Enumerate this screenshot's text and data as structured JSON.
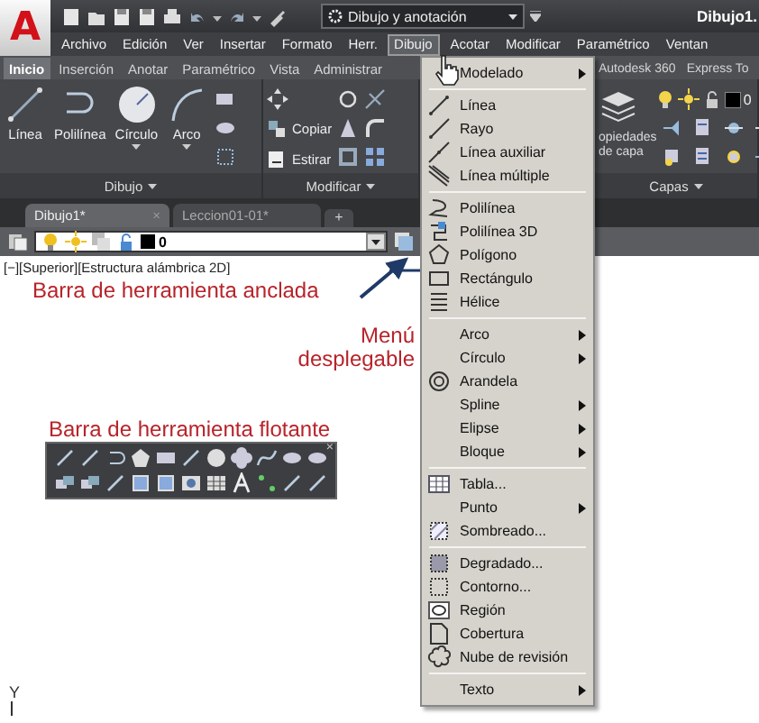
{
  "app_logo": "A",
  "workspace": {
    "value": "Dibujo y anotación"
  },
  "title": "Dibujo1.",
  "menu_bar": [
    {
      "label": "Archivo",
      "selected": false
    },
    {
      "label": "Edición",
      "selected": false
    },
    {
      "label": "Ver",
      "selected": false
    },
    {
      "label": "Insertar",
      "selected": false
    },
    {
      "label": "Formato",
      "selected": false
    },
    {
      "label": "Herr.",
      "selected": false
    },
    {
      "label": "Dibujo",
      "selected": true
    },
    {
      "label": "Acotar",
      "selected": false
    },
    {
      "label": "Modificar",
      "selected": false
    },
    {
      "label": "Paramétrico",
      "selected": false
    },
    {
      "label": "Ventan",
      "selected": false
    }
  ],
  "ribbon_tabs": [
    {
      "label": "Inicio",
      "selected": true
    },
    {
      "label": "Inserción",
      "selected": false
    },
    {
      "label": "Anotar",
      "selected": false
    },
    {
      "label": "Paramétrico",
      "selected": false
    },
    {
      "label": "Vista",
      "selected": false
    },
    {
      "label": "Administrar",
      "selected": false
    }
  ],
  "ribbon_tabs_right": [
    {
      "label": "Autodesk 360",
      "selected": false
    },
    {
      "label": "Express To",
      "selected": false
    }
  ],
  "draw_panel": {
    "label": "Dibujo",
    "tools": [
      {
        "label": "Línea",
        "dropdown": false
      },
      {
        "label": "Polilínea",
        "dropdown": false
      },
      {
        "label": "Círculo",
        "dropdown": true
      },
      {
        "label": "Arco",
        "dropdown": true
      }
    ]
  },
  "modify_panel": {
    "label": "Modificar",
    "tools": [
      "Copiar",
      "Estirar"
    ]
  },
  "layers_panel": {
    "label": "Capas",
    "tool_label": "opiedades\nde capa",
    "current_layer": "0"
  },
  "document_tabs": [
    {
      "label": "Dibujo1*",
      "selected": true,
      "close": "×"
    },
    {
      "label": "Leccion01-01*",
      "selected": false
    }
  ],
  "new_tab": "+",
  "layer_toolbar": {
    "value": "0"
  },
  "viewport_label": "[−][Superior][Estructura alámbrica 2D]",
  "annotations": {
    "docked": "Barra de herramienta anclada",
    "menu": "Menú\ndesplegable",
    "floating": "Barra de herramienta flotante"
  },
  "floating_toolbar": {
    "close": "×"
  },
  "ucs_label": "Y",
  "dropdown_menu": [
    [
      {
        "label": "Modelado",
        "submenu": true
      }
    ],
    [
      {
        "label": "Línea",
        "submenu": false
      },
      {
        "label": "Rayo",
        "submenu": false
      },
      {
        "label": "Línea auxiliar",
        "submenu": false
      },
      {
        "label": "Línea múltiple",
        "submenu": false
      }
    ],
    [
      {
        "label": "Polilínea",
        "submenu": false
      },
      {
        "label": "Polilínea 3D",
        "submenu": false
      },
      {
        "label": "Polígono",
        "submenu": false
      },
      {
        "label": "Rectángulo",
        "submenu": false
      },
      {
        "label": "Hélice",
        "submenu": false
      }
    ],
    [
      {
        "label": "Arco",
        "submenu": true
      },
      {
        "label": "Círculo",
        "submenu": true
      },
      {
        "label": "Arandela",
        "submenu": false
      },
      {
        "label": "Spline",
        "submenu": true
      },
      {
        "label": "Elipse",
        "submenu": true
      },
      {
        "label": "Bloque",
        "submenu": true
      }
    ],
    [
      {
        "label": "Tabla...",
        "submenu": false
      },
      {
        "label": "Punto",
        "submenu": true
      },
      {
        "label": "Sombreado...",
        "submenu": false
      }
    ],
    [
      {
        "label": "Degradado...",
        "submenu": false
      },
      {
        "label": "Contorno...",
        "submenu": false
      },
      {
        "label": "Región",
        "submenu": false
      },
      {
        "label": "Cobertura",
        "submenu": false
      },
      {
        "label": "Nube de revisión",
        "submenu": false
      }
    ],
    [
      {
        "label": "Texto",
        "submenu": true
      }
    ]
  ]
}
